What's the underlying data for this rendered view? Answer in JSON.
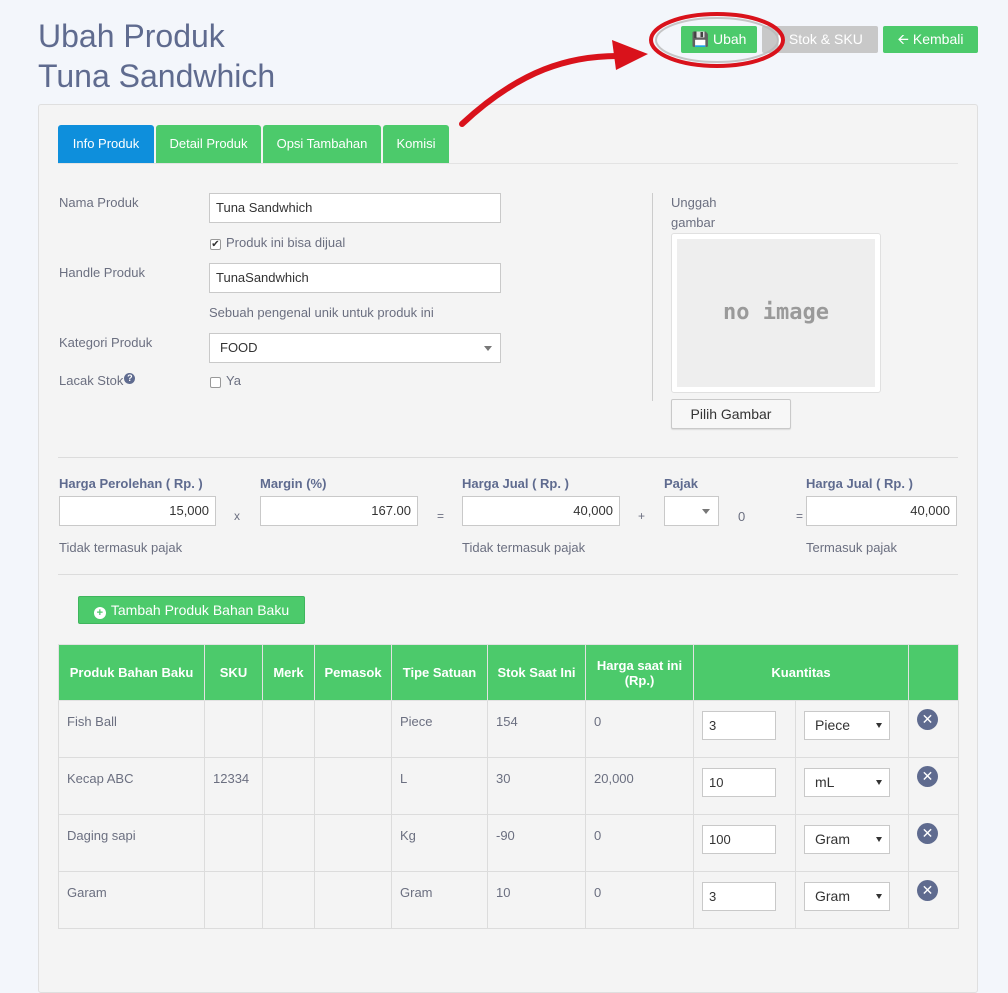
{
  "page": {
    "title_line1": "Ubah Produk",
    "title_line2": "Tuna Sandwhich"
  },
  "toolbar": {
    "ubah_label": "Ubah",
    "stok_label": "Stok & SKU",
    "kembali_label": "Kembali"
  },
  "tabs": [
    {
      "label": "Info Produk",
      "active": true
    },
    {
      "label": "Detail Produk",
      "active": false
    },
    {
      "label": "Opsi Tambahan",
      "active": false
    },
    {
      "label": "Komisi",
      "active": false
    }
  ],
  "form": {
    "nama_label": "Nama Produk",
    "nama_value": "Tuna Sandwhich",
    "bisa_dijual_label": "Produk ini bisa dijual",
    "bisa_dijual_checked": true,
    "handle_label": "Handle Produk",
    "handle_value": "TunaSandwhich",
    "handle_help": "Sebuah pengenal unik untuk produk ini",
    "kategori_label": "Kategori Produk",
    "kategori_value": "FOOD",
    "lacak_label": "Lacak Stok",
    "lacak_option": "Ya",
    "lacak_checked": false
  },
  "image": {
    "upload_label_1": "Unggah",
    "upload_label_2": "gambar",
    "placeholder": "no image",
    "pick_button": "Pilih Gambar"
  },
  "pricing": {
    "harga_perolehan_label": "Harga Perolehan ( Rp. )",
    "harga_perolehan_value": "15,000",
    "harga_perolehan_note": "Tidak termasuk pajak",
    "op_times": "x",
    "margin_label": "Margin (%)",
    "margin_value": "167.00",
    "op_eq1": "=",
    "harga_jual_label": "Harga Jual ( Rp. )",
    "harga_jual_value": "40,000",
    "harga_jual_note": "Tidak termasuk pajak",
    "op_plus": "+",
    "pajak_label": "Pajak",
    "pajak_value": "",
    "pajak_amount": "0",
    "op_eq2": "=",
    "harga_jual_total_label": "Harga Jual ( Rp. )",
    "harga_jual_total_value": "40,000",
    "harga_jual_total_note": "Termasuk pajak"
  },
  "bahan_baku": {
    "add_button": "Tambah Produk Bahan Baku",
    "columns": [
      "Produk Bahan Baku",
      "SKU",
      "Merk",
      "Pemasok",
      "Tipe Satuan",
      "Stok Saat Ini",
      "Harga saat ini (Rp.)",
      "Kuantitas"
    ],
    "rows": [
      {
        "produk": "Fish Ball",
        "sku": "",
        "merk": "",
        "pemasok": "",
        "tipe": "Piece",
        "stok": "154",
        "harga": "0",
        "qty": "3",
        "unit": "Piece"
      },
      {
        "produk": "Kecap ABC",
        "sku": "12334",
        "merk": "",
        "pemasok": "",
        "tipe": "L",
        "stok": "30",
        "harga": "20,000",
        "qty": "10",
        "unit": "mL"
      },
      {
        "produk": "Daging sapi",
        "sku": "",
        "merk": "",
        "pemasok": "",
        "tipe": "Kg",
        "stok": "-90",
        "harga": "0",
        "qty": "100",
        "unit": "Gram"
      },
      {
        "produk": "Garam",
        "sku": "",
        "merk": "",
        "pemasok": "",
        "tipe": "Gram",
        "stok": "10",
        "harga": "0",
        "qty": "3",
        "unit": "Gram"
      }
    ]
  },
  "annotation": {
    "color": "#d9121b"
  }
}
